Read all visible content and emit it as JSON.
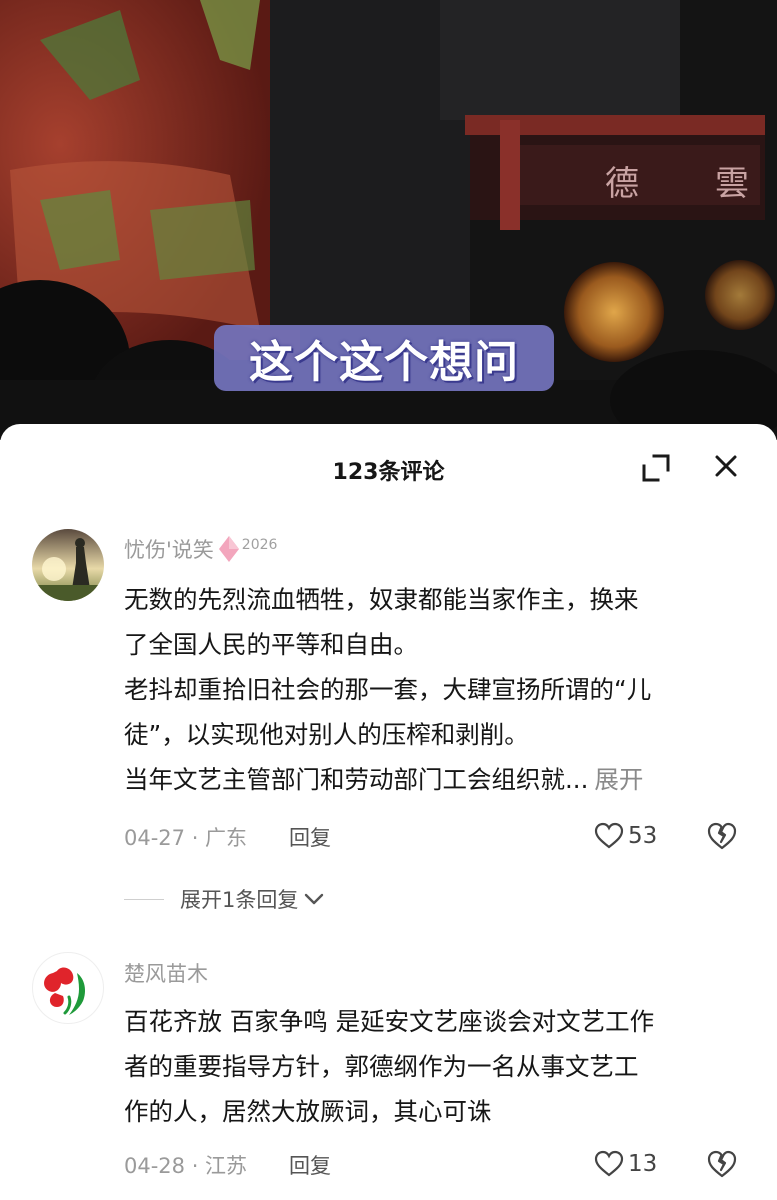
{
  "video": {
    "subtitle": "这个这个想问"
  },
  "comments_panel": {
    "title": "123条评论",
    "expand_icon": "expand-icon",
    "close_icon": "close-icon"
  },
  "comments": [
    {
      "author": "忧伤'说笑",
      "badge_year": "2026",
      "lines": [
        "无数的先烈流血牺牲，奴隶都能当家作主，换来",
        "了全国人民的平等和自由。",
        "老抖却重拾旧社会的那一套，大肆宣扬所谓的“儿",
        "徒”，以实现他对别人的压榨和剥削。",
        "当年文艺主管部门和劳动部门工会组织就..."
      ],
      "expand_label": "展开",
      "date_location": "04-27 · 广东",
      "reply_label": "回复",
      "likes": "53",
      "more_replies_label": "展开1条回复"
    },
    {
      "author": "楚风苗木",
      "lines": [
        "百花齐放 百家争鸣 是延安文艺座谈会对文艺工作",
        "者的重要指导方针，郭德纲作为一名从事文艺工",
        "作的人，居然大放厥词，其心可诛"
      ],
      "date_location": "04-28 · 江苏",
      "reply_label": "回复",
      "likes": "13"
    }
  ],
  "colors": {
    "subtitle_bg": "#7474be",
    "text_primary": "#161616",
    "text_secondary": "#9a9a9a",
    "badge": "#f3a6bd"
  }
}
